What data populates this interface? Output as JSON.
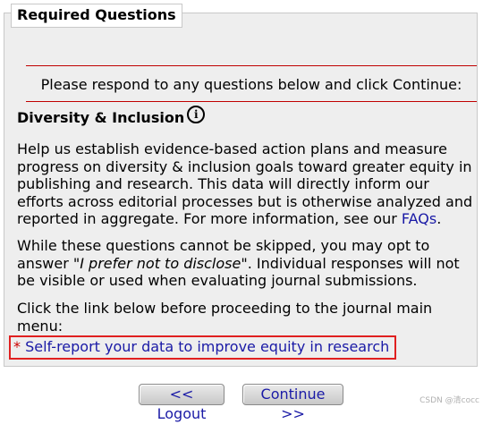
{
  "panel": {
    "legend": "Required Questions",
    "instruction": "Please respond to any questions below and click Continue:"
  },
  "section": {
    "title": "Diversity & Inclusion",
    "info_icon": "i",
    "paragraph1_text": "Help us establish evidence-based action plans and measure progress on diversity & inclusion goals toward greater equity in publishing and research. This data will directly inform our efforts across editorial processes but is otherwise analyzed and reported in aggregate. For more information, see our ",
    "faq_link": "FAQs",
    "paragraph1_end": ".",
    "paragraph2_start": "While these questions cannot be skipped, you may opt to answer ",
    "paragraph2_quote": "\"I prefer not to disclose\"",
    "paragraph2_end": ". Individual responses will not be visible or used when evaluating journal submissions.",
    "paragraph3": "Click the link below before proceeding to the journal main menu:"
  },
  "report_link": {
    "asterisk": "*",
    "label": "Self-report your data to improve equity in research"
  },
  "buttons": {
    "logout": "<< Logout",
    "continue": "Continue >>"
  },
  "watermark": "CSDN @清cocc",
  "colors": {
    "panel_bg": "#eeeeee",
    "rule": "#c00000",
    "link": "#1a1aa6",
    "highlight_border": "#e02020"
  }
}
